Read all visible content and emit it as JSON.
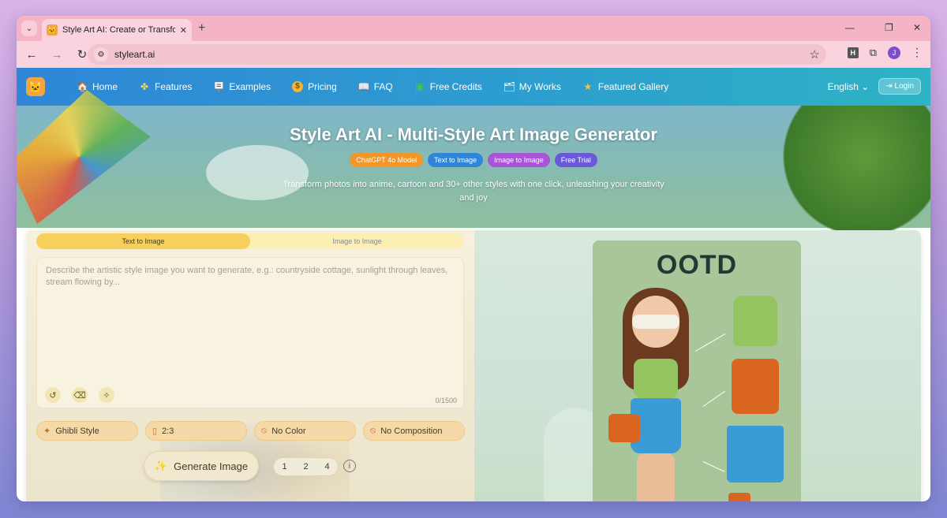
{
  "browser": {
    "tab_title": "Style Art AI: Create or Transform",
    "tab_close": "✕",
    "new_tab": "+",
    "url": "styleart.ai",
    "profile_initial": "J",
    "extension_label": "H"
  },
  "nav": {
    "items": [
      {
        "label": "Home",
        "icon": "home-icon",
        "glyph": "🏠"
      },
      {
        "label": "Features",
        "icon": "features-icon",
        "glyph": "✤"
      },
      {
        "label": "Examples",
        "icon": "examples-icon",
        "glyph": "🪧"
      },
      {
        "label": "Pricing",
        "icon": "pricing-icon",
        "glyph": "$"
      },
      {
        "label": "FAQ",
        "icon": "faq-icon",
        "glyph": "📖"
      },
      {
        "label": "Free Credits",
        "icon": "free-icon",
        "glyph": "▣"
      },
      {
        "label": "My Works",
        "icon": "works-icon",
        "glyph": "🗂"
      },
      {
        "label": "Featured Gallery",
        "icon": "star-icon",
        "glyph": "★"
      }
    ],
    "language": "English",
    "login": "Login"
  },
  "hero": {
    "title": "Style Art AI - Multi-Style Art Image Generator",
    "badges": [
      {
        "label": "ChatGPT 4o Model",
        "color": "#f0972a"
      },
      {
        "label": "Text to Image",
        "color": "#2f86d6"
      },
      {
        "label": "Image to Image",
        "color": "#a855d8"
      },
      {
        "label": "Free Trial",
        "color": "#6a5ad8"
      }
    ],
    "subtitle": "Transform photos into anime, cartoon and 30+ other styles with one click, unleashing your creativity and joy"
  },
  "generator": {
    "modes": [
      "Text to Image",
      "Image to Image"
    ],
    "active_mode": "Text to Image",
    "prompt_placeholder": "Describe the artistic style image you want to generate, e.g.: countryside cottage, sunlight through leaves, stream flowing by...",
    "prompt_value": "",
    "char_count": "0/1500",
    "options": [
      {
        "label": "Ghibli Style",
        "icon": "sparkle-icon",
        "glyph": "✦"
      },
      {
        "label": "2:3",
        "icon": "aspect-ratio-icon",
        "glyph": "▯"
      },
      {
        "label": "No Color",
        "icon": "ban-icon",
        "glyph": "⃠"
      },
      {
        "label": "No Composition",
        "icon": "ban-icon",
        "glyph": "⃠"
      }
    ],
    "generate_label": "Generate Image",
    "count_options": [
      "1",
      "2",
      "4"
    ]
  },
  "preview": {
    "card_title": "OOTD"
  },
  "colors": {
    "nav_start": "#2f86d6",
    "nav_end": "#2db3c4",
    "tab_strip": "#f5b3c6",
    "active_mode": "#f7cf5c"
  }
}
